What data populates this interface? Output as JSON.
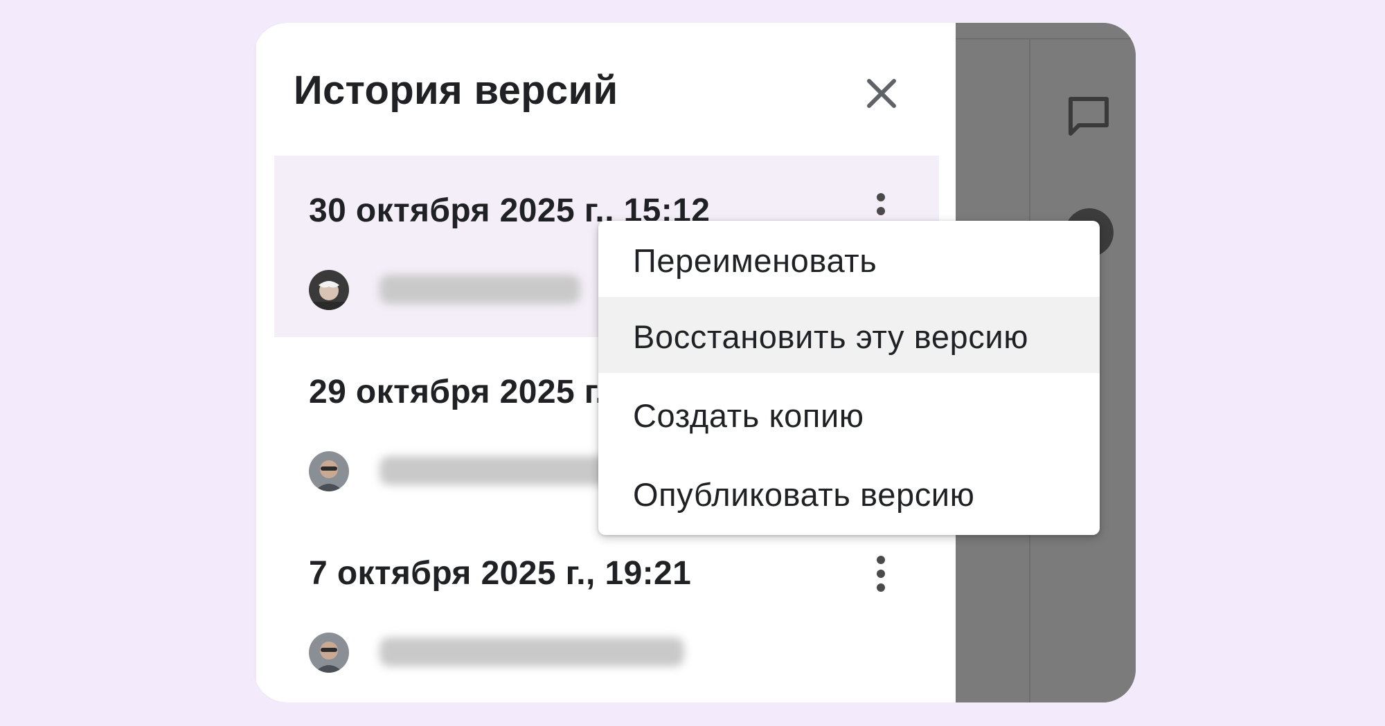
{
  "panel": {
    "title": "История версий",
    "close_icon": "close-icon"
  },
  "versions": [
    {
      "date": "30 октября 2025 г., 15:12",
      "selected": true
    },
    {
      "date": "29 октября 2025 г.",
      "selected": false
    },
    {
      "date": "7 октября 2025 г., 19:21",
      "selected": false
    }
  ],
  "context_menu": {
    "items": [
      {
        "label": "Переименовать"
      },
      {
        "label": "Восстановить эту версию",
        "highlighted": true
      },
      {
        "label": "Создать копию"
      },
      {
        "label": "Опубликовать версию"
      }
    ]
  },
  "side_toolbar": {
    "icons": [
      "comment-icon",
      "avatar"
    ]
  },
  "colors": {
    "page_bg": "#f3ebfb",
    "selected_row_bg": "#f4eef8",
    "overlay_bg": "#7b7b7b",
    "menu_hover_bg": "#f1f1f1"
  }
}
